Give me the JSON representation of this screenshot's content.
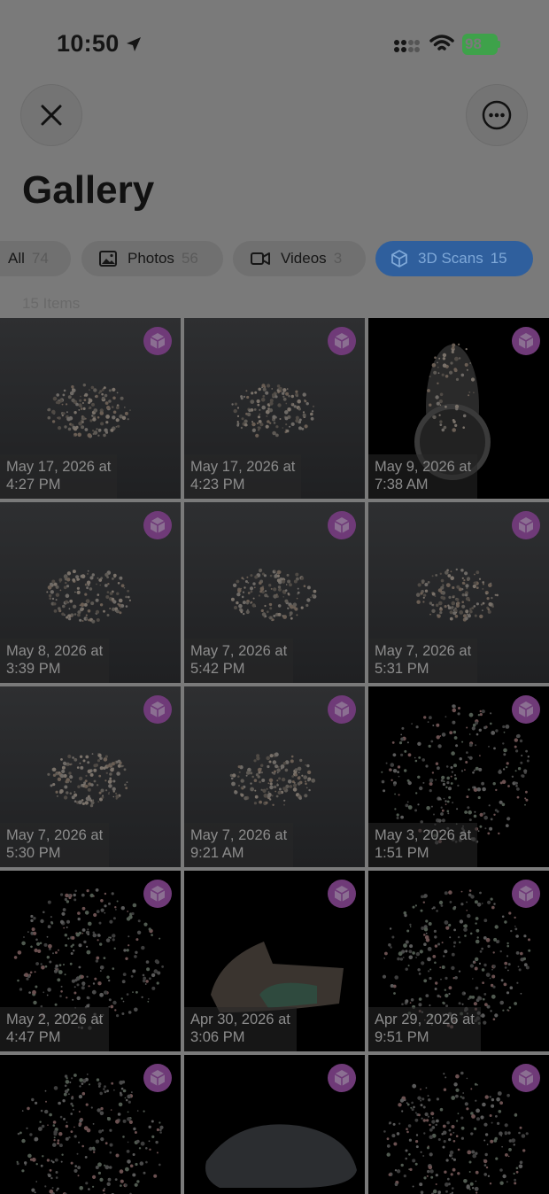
{
  "status": {
    "time": "10:50",
    "battery": "98"
  },
  "header": {
    "title": "Gallery"
  },
  "filters": [
    {
      "label": "All",
      "count": "74"
    },
    {
      "label": "Photos",
      "count": "56"
    },
    {
      "label": "Videos",
      "count": "3"
    },
    {
      "label": "3D Scans",
      "count": "15"
    }
  ],
  "items_count": "15 Items",
  "tiles": [
    {
      "date": "May 17, 2026 at",
      "time": "4:27 PM"
    },
    {
      "date": "May 17, 2026 at",
      "time": "4:23 PM"
    },
    {
      "date": "May 9, 2026 at",
      "time": "7:38 AM"
    },
    {
      "date": "May 8, 2026 at",
      "time": "3:39 PM"
    },
    {
      "date": "May 7, 2026 at",
      "time": "5:42 PM"
    },
    {
      "date": "May 7, 2026 at",
      "time": "5:31 PM"
    },
    {
      "date": "May 7, 2026 at",
      "time": "5:30 PM"
    },
    {
      "date": "May 7, 2026 at",
      "time": "9:21 AM"
    },
    {
      "date": "May 3, 2026 at",
      "time": "1:51 PM"
    },
    {
      "date": "May 2, 2026 at",
      "time": "4:47 PM"
    },
    {
      "date": "Apr 30, 2026 at",
      "time": "3:06 PM"
    },
    {
      "date": "Apr 29, 2026 at",
      "time": "9:51 PM"
    }
  ]
}
